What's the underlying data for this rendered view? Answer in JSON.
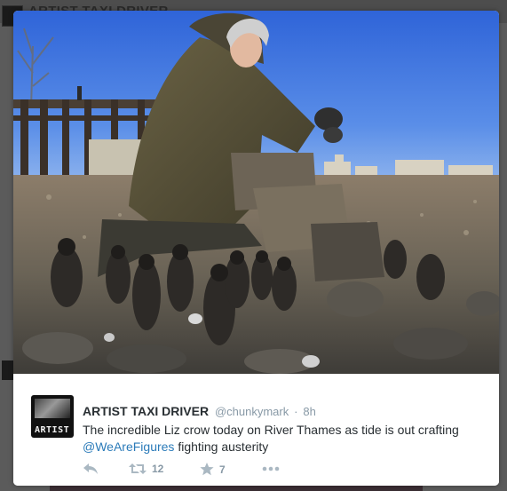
{
  "background": {
    "header_title": "ARTIST TAXI DRIVER",
    "colors": {
      "backdrop": "#5b5b5b"
    }
  },
  "tweet": {
    "author_name": "ARTIST TAXI DRIVER",
    "handle": "@chunkymark",
    "separator": "·",
    "time": "8h",
    "avatar_label": "ARTIST",
    "text_main": "The incredible Liz crow today on River Thames as tide is out crafting",
    "mention": "@WeAreFigures",
    "text_tail": " fighting austerity",
    "actions": {
      "reply_icon": "reply-icon",
      "retweet_icon": "retweet-icon",
      "retweet_count": "12",
      "favorite_icon": "star-icon",
      "favorite_count": "7",
      "more_icon": "more-dots-icon"
    },
    "colors": {
      "link": "#2b7bb9",
      "name": "#292f33",
      "muted": "#8899a6",
      "icon": "#aab8c2"
    }
  },
  "photo": {
    "subject": "woman-kneeling-on-riverbank-with-clay-figures"
  }
}
